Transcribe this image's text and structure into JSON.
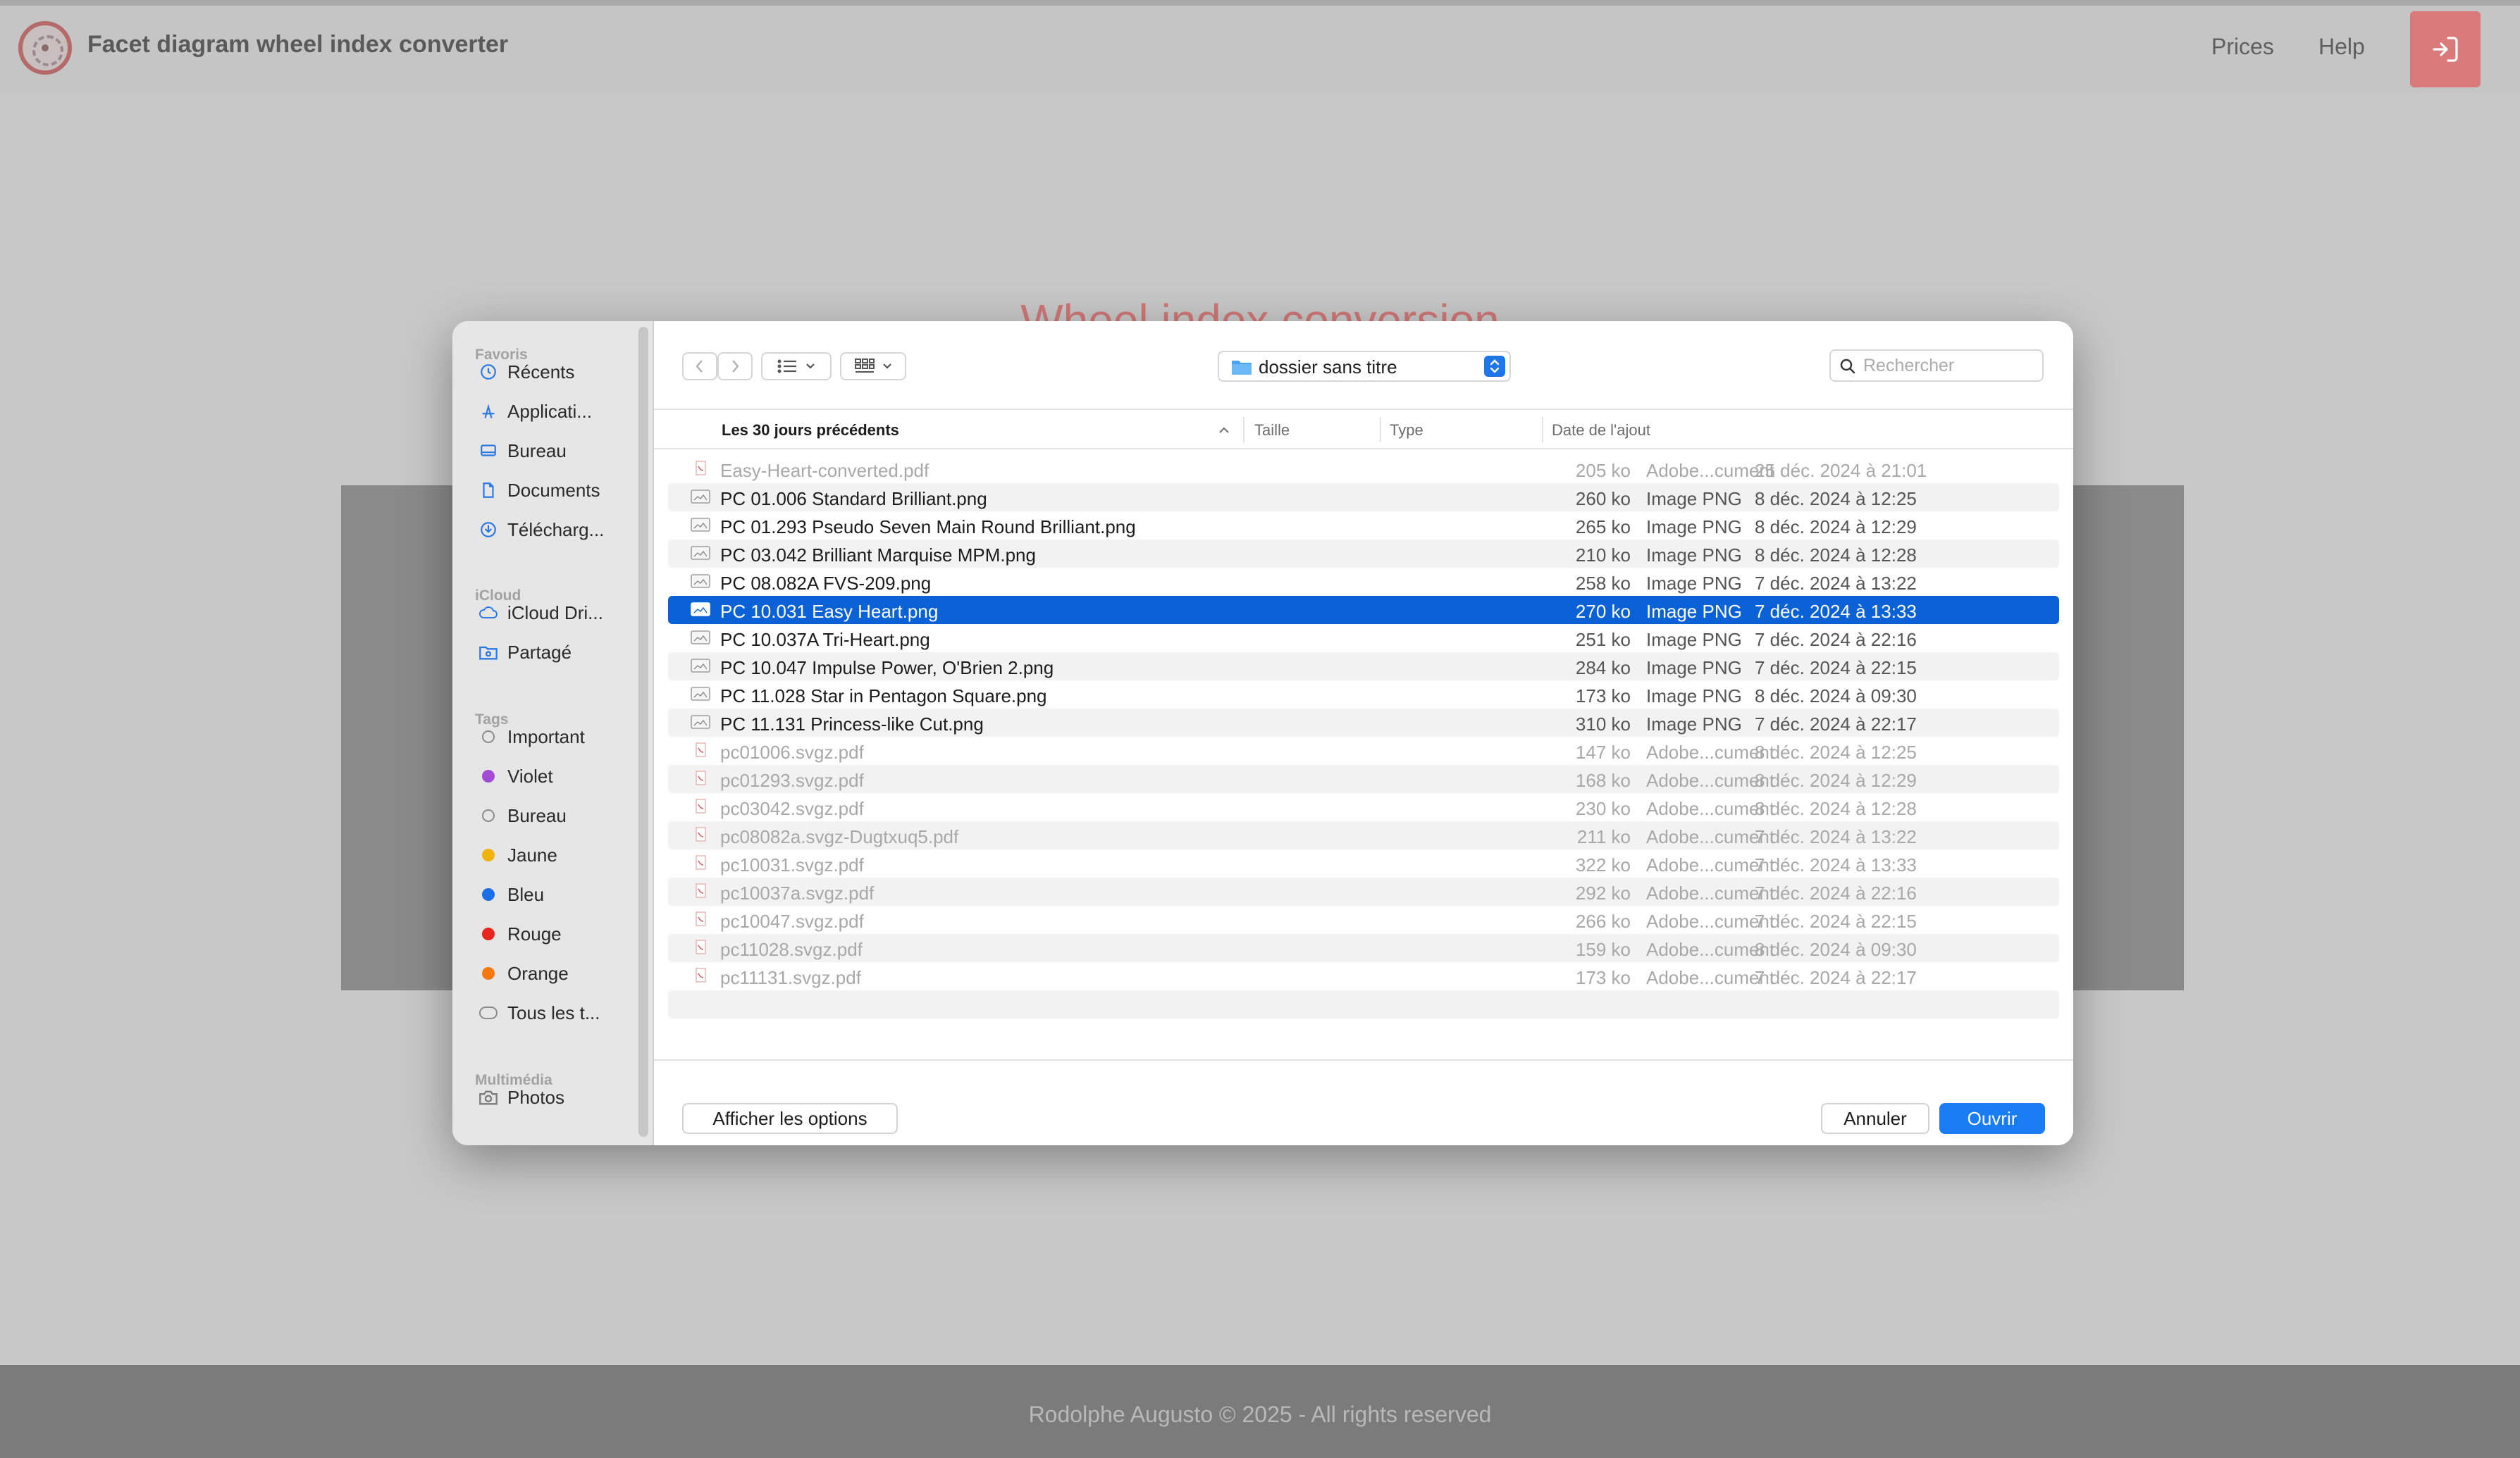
{
  "page": {
    "brand": "Facet diagram wheel index converter",
    "nav": {
      "prices": "Prices",
      "help": "Help"
    },
    "heading": "Wheel index conversion",
    "footer": "Rodolphe Augusto © 2025 - All rights reserved"
  },
  "colors": {
    "accent": "#d97979",
    "selection": "#0b62d6",
    "primary_button": "#1a7cf2"
  },
  "dialog": {
    "sidebar": {
      "sections": [
        {
          "title": "Favoris"
        },
        {
          "title": "iCloud"
        },
        {
          "title": "Tags"
        },
        {
          "title": "Multimédia"
        }
      ],
      "favorites": [
        {
          "label": "Récents",
          "icon": "clock-icon"
        },
        {
          "label": "Applicati...",
          "icon": "applications-icon"
        },
        {
          "label": "Bureau",
          "icon": "desktop-icon"
        },
        {
          "label": "Documents",
          "icon": "document-icon"
        },
        {
          "label": "Télécharg...",
          "icon": "download-icon"
        }
      ],
      "icloud": [
        {
          "label": "iCloud Dri...",
          "icon": "cloud-icon"
        },
        {
          "label": "Partagé",
          "icon": "shared-folder-icon"
        }
      ],
      "tags": [
        {
          "label": "Important",
          "color": ""
        },
        {
          "label": "Violet",
          "color": "#a24bd4"
        },
        {
          "label": "Bureau",
          "color": ""
        },
        {
          "label": "Jaune",
          "color": "#f2b20c"
        },
        {
          "label": "Bleu",
          "color": "#1a6fe8"
        },
        {
          "label": "Rouge",
          "color": "#e8261f"
        },
        {
          "label": "Orange",
          "color": "#f5780f"
        },
        {
          "label": "Tous les t...",
          "color": ""
        }
      ],
      "media": [
        {
          "label": "Photos",
          "icon": "camera-icon"
        }
      ]
    },
    "toolbar": {
      "path": "dossier sans titre",
      "search_placeholder": "Rechercher"
    },
    "columns": {
      "name": "Les 30 jours précédents",
      "size": "Taille",
      "type": "Type",
      "date": "Date de l'ajout"
    },
    "files": [
      {
        "name": "Easy-Heart-converted.pdf",
        "size": "205 ko",
        "type": "Adobe...cument",
        "date": "25 déc. 2024 à 21:01",
        "kind": "pdf",
        "enabled": false,
        "selected": false
      },
      {
        "name": "PC 01.006 Standard Brilliant.png",
        "size": "260 ko",
        "type": "Image PNG",
        "date": "8 déc. 2024 à 12:25",
        "kind": "png",
        "enabled": true,
        "selected": false
      },
      {
        "name": "PC 01.293 Pseudo Seven Main Round Brilliant.png",
        "size": "265 ko",
        "type": "Image PNG",
        "date": "8 déc. 2024 à 12:29",
        "kind": "png",
        "enabled": true,
        "selected": false
      },
      {
        "name": "PC 03.042 Brilliant Marquise MPM.png",
        "size": "210 ko",
        "type": "Image PNG",
        "date": "8 déc. 2024 à 12:28",
        "kind": "png",
        "enabled": true,
        "selected": false
      },
      {
        "name": "PC 08.082A FVS-209.png",
        "size": "258 ko",
        "type": "Image PNG",
        "date": "7 déc. 2024 à 13:22",
        "kind": "png",
        "enabled": true,
        "selected": false
      },
      {
        "name": "PC 10.031 Easy Heart.png",
        "size": "270 ko",
        "type": "Image PNG",
        "date": "7 déc. 2024 à 13:33",
        "kind": "png",
        "enabled": true,
        "selected": true
      },
      {
        "name": "PC 10.037A Tri-Heart.png",
        "size": "251 ko",
        "type": "Image PNG",
        "date": "7 déc. 2024 à 22:16",
        "kind": "png",
        "enabled": true,
        "selected": false
      },
      {
        "name": "PC 10.047 Impulse Power, O'Brien 2.png",
        "size": "284 ko",
        "type": "Image PNG",
        "date": "7 déc. 2024 à 22:15",
        "kind": "png",
        "enabled": true,
        "selected": false
      },
      {
        "name": "PC 11.028 Star in Pentagon Square.png",
        "size": "173 ko",
        "type": "Image PNG",
        "date": "8 déc. 2024 à 09:30",
        "kind": "png",
        "enabled": true,
        "selected": false
      },
      {
        "name": "PC 11.131 Princess-like Cut.png",
        "size": "310 ko",
        "type": "Image PNG",
        "date": "7 déc. 2024 à 22:17",
        "kind": "png",
        "enabled": true,
        "selected": false
      },
      {
        "name": "pc01006.svgz.pdf",
        "size": "147 ko",
        "type": "Adobe...cument",
        "date": "8 déc. 2024 à 12:25",
        "kind": "pdf",
        "enabled": false,
        "selected": false
      },
      {
        "name": "pc01293.svgz.pdf",
        "size": "168 ko",
        "type": "Adobe...cument",
        "date": "8 déc. 2024 à 12:29",
        "kind": "pdf",
        "enabled": false,
        "selected": false
      },
      {
        "name": "pc03042.svgz.pdf",
        "size": "230 ko",
        "type": "Adobe...cument",
        "date": "8 déc. 2024 à 12:28",
        "kind": "pdf",
        "enabled": false,
        "selected": false
      },
      {
        "name": "pc08082a.svgz-Dugtxuq5.pdf",
        "size": "211 ko",
        "type": "Adobe...cument",
        "date": "7 déc. 2024 à 13:22",
        "kind": "pdf",
        "enabled": false,
        "selected": false
      },
      {
        "name": "pc10031.svgz.pdf",
        "size": "322 ko",
        "type": "Adobe...cument",
        "date": "7 déc. 2024 à 13:33",
        "kind": "pdf",
        "enabled": false,
        "selected": false
      },
      {
        "name": "pc10037a.svgz.pdf",
        "size": "292 ko",
        "type": "Adobe...cument",
        "date": "7 déc. 2024 à 22:16",
        "kind": "pdf",
        "enabled": false,
        "selected": false
      },
      {
        "name": "pc10047.svgz.pdf",
        "size": "266 ko",
        "type": "Adobe...cument",
        "date": "7 déc. 2024 à 22:15",
        "kind": "pdf",
        "enabled": false,
        "selected": false
      },
      {
        "name": "pc11028.svgz.pdf",
        "size": "159 ko",
        "type": "Adobe...cument",
        "date": "8 déc. 2024 à 09:30",
        "kind": "pdf",
        "enabled": false,
        "selected": false
      },
      {
        "name": "pc11131.svgz.pdf",
        "size": "173 ko",
        "type": "Adobe...cument",
        "date": "7 déc. 2024 à 22:17",
        "kind": "pdf",
        "enabled": false,
        "selected": false
      }
    ],
    "buttons": {
      "options": "Afficher les options",
      "cancel": "Annuler",
      "open": "Ouvrir"
    }
  }
}
